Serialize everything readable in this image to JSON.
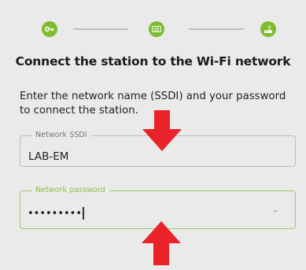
{
  "stepper": {
    "steps": [
      {
        "icon": "key-icon"
      },
      {
        "icon": "wifi-dots-icon"
      },
      {
        "icon": "router-icon"
      }
    ],
    "active_color": "#7dbb2f"
  },
  "title": "Connect the station to the Wi-Fi network",
  "description": "Enter the network name (SSDI) and your password to connect the station.",
  "ssid_field": {
    "label": "Network SSDI",
    "value": "LAB-EM"
  },
  "password_field": {
    "label": "Network password",
    "value": "•••••••••",
    "toggle_glyph": "–"
  },
  "annotation_color": "#e8232a"
}
